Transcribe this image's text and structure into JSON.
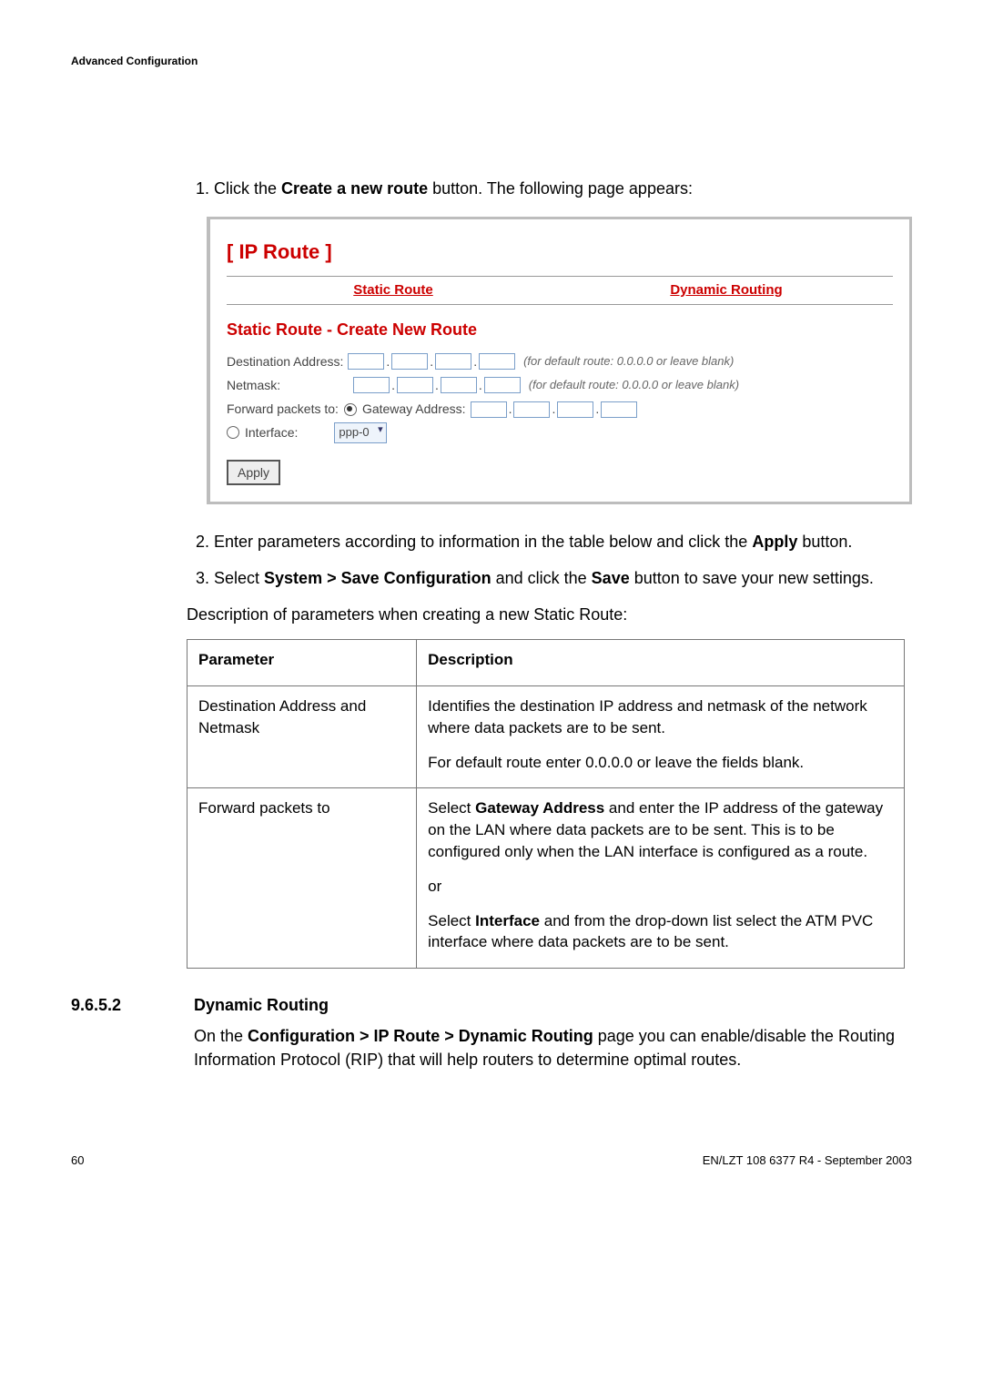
{
  "header": {
    "section": "Advanced Configuration"
  },
  "steps": {
    "s1_pre": "Click the ",
    "s1_bold": "Create a new route",
    "s1_post": " button. The following page appears:",
    "s2_pre": "Enter parameters according to information in the table below and click the ",
    "s2_bold": "Apply",
    "s2_post": " button.",
    "s3_pre": "Select ",
    "s3_bold1": "System > Save Configuration",
    "s3_mid": " and click the ",
    "s3_bold2": "Save",
    "s3_post": " button to save your new settings."
  },
  "shot": {
    "title": "[ IP Route ]",
    "tab_static": "Static Route",
    "tab_dynamic": "Dynamic Routing",
    "subtitle": "Static Route - Create New Route",
    "dest_label": "Destination Address:",
    "netmask_label": "Netmask:",
    "hint": "(for default route: 0.0.0.0 or leave blank)",
    "forward_label": "Forward packets to:",
    "gw_label": "Gateway Address:",
    "iface_label": "Interface:",
    "iface_value": "ppp-0",
    "apply": "Apply"
  },
  "desc_intro": "Description of parameters when creating a new Static Route:",
  "table": {
    "h1": "Parameter",
    "h2": "Description",
    "r1p": "Destination Address and Netmask",
    "r1d_a": "Identifies the destination IP address and netmask of the network where data packets are to be sent.",
    "r1d_b": "For default route enter 0.0.0.0 or leave the fields blank.",
    "r2p": "Forward packets to",
    "r2d_a_pre": "Select ",
    "r2d_a_bold": "Gateway Address",
    "r2d_a_post": " and enter the IP address of the gateway on the LAN where data packets are to be sent. This is to be configured only when the LAN interface is configured as a route.",
    "r2d_or": "or",
    "r2d_b_pre": "Select ",
    "r2d_b_bold": "Interface",
    "r2d_b_post": " and from the drop-down list select the ATM PVC interface where data packets are to be sent."
  },
  "section": {
    "num": "9.6.5.2",
    "title": "Dynamic Routing",
    "body_pre": "On the ",
    "body_bold": "Configuration > IP Route > Dynamic Routing",
    "body_post": " page you can enable/disable the Routing Information Protocol (RIP) that will help routers to determine optimal routes."
  },
  "footer": {
    "page": "60",
    "doc": "EN/LZT 108 6377 R4 - September 2003"
  }
}
